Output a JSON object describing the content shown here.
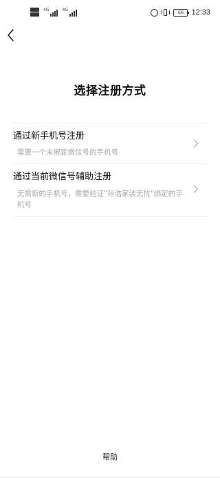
{
  "status_bar": {
    "sim1_network": "4G",
    "sim2_network": "4G",
    "battery_level": "66",
    "time": "12:33",
    "icons": [
      "hd-icon",
      "signal-icon",
      "alarm-icon",
      "vibrate-icon",
      "battery-icon"
    ]
  },
  "header": {
    "back_icon": "chevron-left-icon"
  },
  "title": "选择注册方式",
  "options": [
    {
      "title": "通过新手机号注册",
      "description": "需要一个未绑定微信号的手机号",
      "icon": "chevron-right-icon"
    },
    {
      "title": "通过当前微信号辅助注册",
      "description": "无需新的手机号，需要验证\"孙浩家装无忧\"绑定的手机号",
      "icon": "chevron-right-icon"
    }
  ],
  "footer": {
    "help_label": "帮助"
  },
  "colors": {
    "background": "#ffffff",
    "title": "#111111",
    "secondary_text": "#a6a6a6",
    "divider": "#ececec",
    "chevron": "#b3b3b3"
  }
}
